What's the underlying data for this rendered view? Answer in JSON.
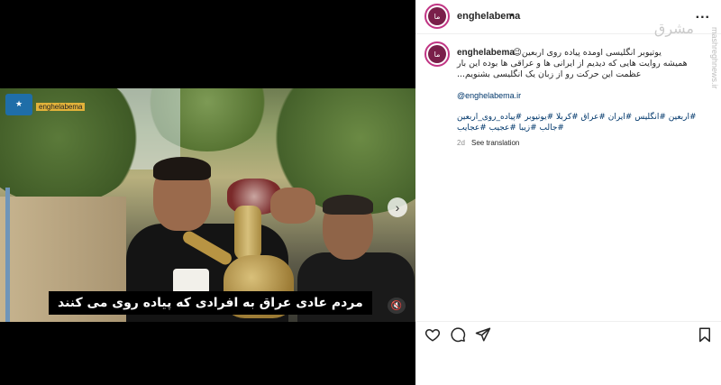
{
  "post": {
    "header": {
      "username": "enghelabema",
      "dot": "•",
      "more": "..."
    },
    "watermark": {
      "logo_text": "مشرق",
      "side_text": "mashreghnews.ir"
    },
    "caption": {
      "username": "enghelabema",
      "line1": "یوتیوبر انگلیسی اومده پیاده روی اربعین😉",
      "line2": "همیشه روایت هایی که دیدیم از ایرانی ها و عراقی ها بوده این بار",
      "line3": "عظمت این حرکت رو از زبان یک انگلیسی بشنویم...",
      "mention": "@enghelabema.ir",
      "hashtags_line1": "#اربعین #انگلیس #ایران #عراق #کربلا #یوتیوبر #پیاده_روی_اربعین",
      "hashtags_line2": "#جالب #زیبا #عجیب #عجایب",
      "age": "2d",
      "see_translation": "See translation"
    },
    "media": {
      "channel_tag": "enghelabema",
      "subtitle": "مردم عادی عراق به افرادی که پیاده روی می کنند",
      "next_icon": "chevron-right-icon",
      "mute_icon": "speaker-icon"
    },
    "actions": {
      "like_icon": "heart-icon",
      "comment_icon": "comment-icon",
      "share_icon": "paper-plane-icon",
      "save_icon": "bookmark-icon"
    }
  }
}
